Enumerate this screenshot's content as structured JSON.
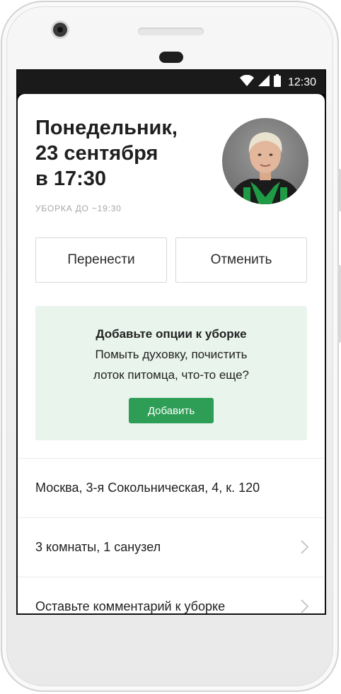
{
  "status_bar": {
    "time": "12:30"
  },
  "appointment": {
    "title_line1": "Понедельник,",
    "title_line2": "23 сентября",
    "title_line3": "в 17:30",
    "subtitle": "УБОРКА ДО ~19:30"
  },
  "actions": {
    "reschedule_label": "Перенести",
    "cancel_label": "Отменить"
  },
  "promo": {
    "title": "Добавьте опции к уборке",
    "line1": "Помыть духовку, почистить",
    "line2": "лоток питомца, что-то еще?",
    "button_label": "Добавить"
  },
  "details": {
    "address": "Москва, 3-я Сокольническая, 4, к. 120",
    "rooms": "3 комнаты, 1 санузел",
    "comment": "Оставьте комментарий к уборке"
  },
  "colors": {
    "accent": "#2e9e56",
    "promo_background": "#e8f4ec",
    "status_bar": "#1a1a1a"
  }
}
